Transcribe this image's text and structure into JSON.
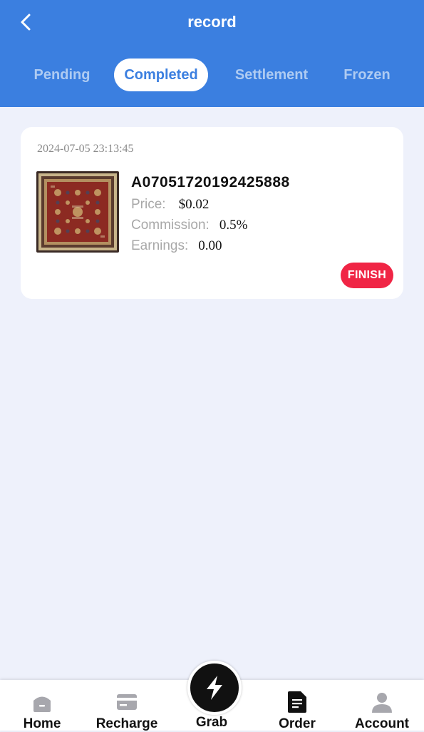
{
  "header": {
    "title": "record",
    "back_icon": "chevron-left-icon",
    "background": "#3b7fe0"
  },
  "tabs": [
    {
      "label": "Pending",
      "active": false
    },
    {
      "label": "Completed",
      "active": true
    },
    {
      "label": "Settlement",
      "active": false
    },
    {
      "label": "Frozen",
      "active": false
    }
  ],
  "orders": [
    {
      "timestamp": "2024-07-05 23:13:45",
      "image": "rug-thumbnail",
      "order_id": "A07051720192425888",
      "price_label": "Price:",
      "price_value": "$0.02",
      "commission_label": "Commission:",
      "commission_value": "0.5%",
      "earnings_label": "Earnings:",
      "earnings_value": "0.00",
      "status": "FINISH",
      "status_color": "#f02545"
    }
  ],
  "bottom_nav": {
    "items": [
      {
        "label": "Home",
        "icon": "home-icon"
      },
      {
        "label": "Recharge",
        "icon": "card-icon"
      },
      {
        "label": "Grab",
        "icon": "lightning-icon"
      },
      {
        "label": "Order",
        "icon": "document-icon"
      },
      {
        "label": "Account",
        "icon": "user-icon"
      }
    ]
  }
}
